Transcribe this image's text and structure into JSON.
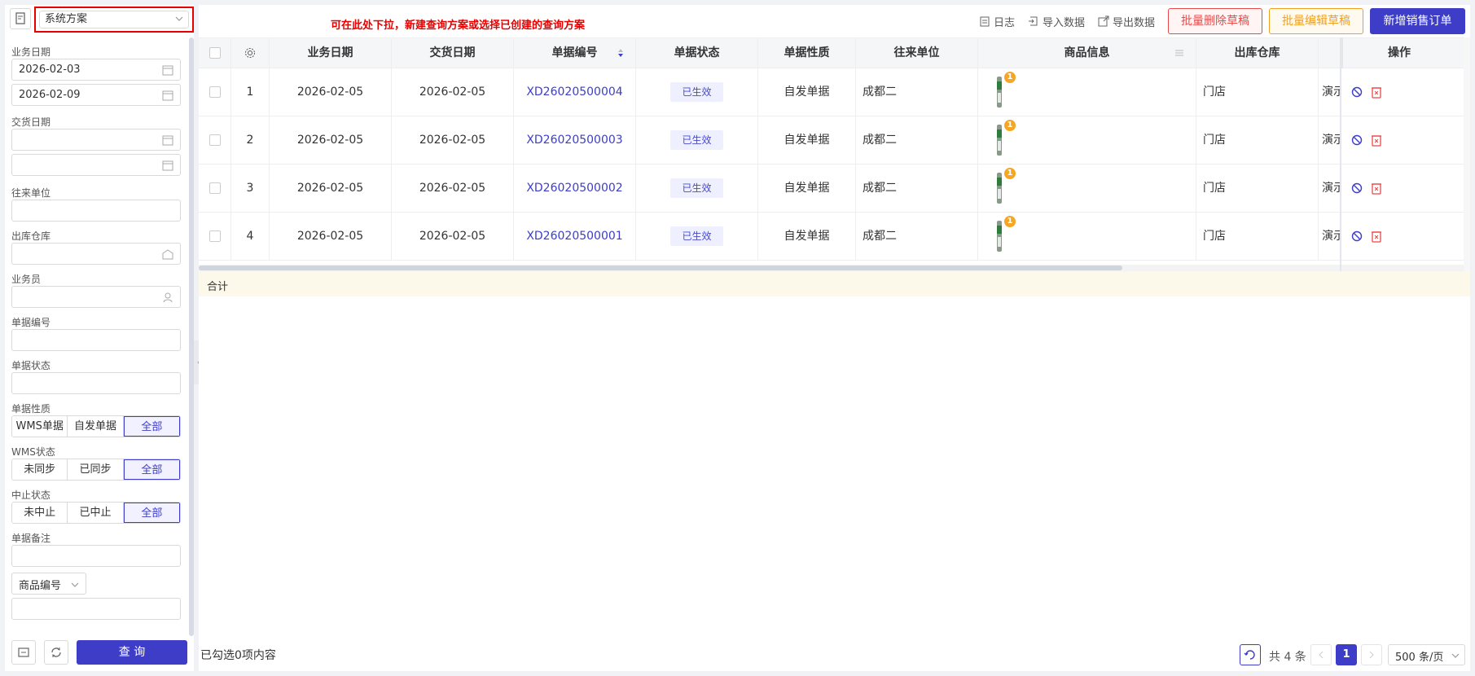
{
  "scheme": {
    "label": "系统方案"
  },
  "annotation": "可在此处下拉，新建查询方案或选择已创建的查询方案",
  "filters": {
    "business_date_label": "业务日期",
    "business_date_from": "2026-02-03",
    "business_date_to": "2026-02-09",
    "delivery_date_label": "交货日期",
    "partner_label": "往来单位",
    "warehouse_label": "出库仓库",
    "salesperson_label": "业务员",
    "doc_no_label": "单据编号",
    "doc_status_label": "单据状态",
    "doc_nature_label": "单据性质",
    "doc_nature_options": [
      "WMS单据",
      "自发单据",
      "全部"
    ],
    "wms_status_label": "WMS状态",
    "wms_status_options": [
      "未同步",
      "已同步",
      "全部"
    ],
    "suspend_status_label": "中止状态",
    "suspend_status_options": [
      "未中止",
      "已中止",
      "全部"
    ],
    "remark_label": "单据备注",
    "product_code_select": "商品编号",
    "query_button": "查 询"
  },
  "toolbar": {
    "log": "日志",
    "import": "导入数据",
    "export": "导出数据",
    "batch_delete": "批量删除草稿",
    "batch_edit": "批量编辑草稿",
    "new_order": "新增销售订单"
  },
  "table": {
    "headers": [
      "业务日期",
      "交货日期",
      "单据编号",
      "单据状态",
      "单据性质",
      "往来单位",
      "商品信息",
      "出库仓库",
      "操作"
    ],
    "rows": [
      {
        "no": "1",
        "business_date": "2026-02-05",
        "delivery_date": "2026-02-05",
        "doc_no": "XD26020500004",
        "status": "已生效",
        "nature": "自发单据",
        "partner": "成都二",
        "badge": "1",
        "warehouse": "门店",
        "extra": "演示"
      },
      {
        "no": "2",
        "business_date": "2026-02-05",
        "delivery_date": "2026-02-05",
        "doc_no": "XD26020500003",
        "status": "已生效",
        "nature": "自发单据",
        "partner": "成都二",
        "badge": "1",
        "warehouse": "门店",
        "extra": "演示"
      },
      {
        "no": "3",
        "business_date": "2026-02-05",
        "delivery_date": "2026-02-05",
        "doc_no": "XD26020500002",
        "status": "已生效",
        "nature": "自发单据",
        "partner": "成都二",
        "badge": "1",
        "warehouse": "门店",
        "extra": "演示"
      },
      {
        "no": "4",
        "business_date": "2026-02-05",
        "delivery_date": "2026-02-05",
        "doc_no": "XD26020500001",
        "status": "已生效",
        "nature": "自发单据",
        "partner": "成都二",
        "badge": "1",
        "warehouse": "门店",
        "extra": "演示"
      }
    ],
    "total_label": "合计"
  },
  "footer": {
    "selected": "已勾选0项内容",
    "total": "共 4 条",
    "page": "1",
    "page_size": "500 条/页"
  },
  "colors": {
    "primary": "#3d3dc8",
    "danger": "#e84a4a",
    "warning": "#f0a020",
    "annotation": "#e60000"
  }
}
